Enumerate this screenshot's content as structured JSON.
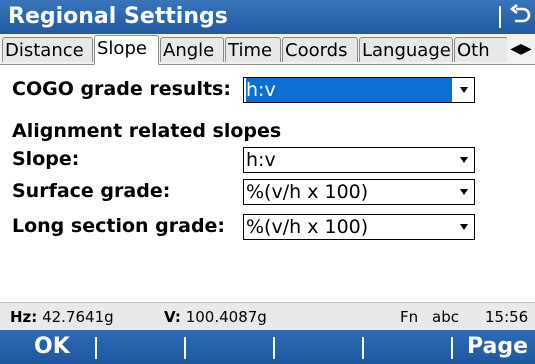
{
  "window": {
    "title": "Regional Settings"
  },
  "tabs": [
    {
      "label": "Distance"
    },
    {
      "label": "Slope"
    },
    {
      "label": "Angle"
    },
    {
      "label": "Time"
    },
    {
      "label": "Coords"
    },
    {
      "label": "Language"
    },
    {
      "label": "Oth"
    }
  ],
  "tab_scroll": {
    "left": "◀",
    "right": "▶"
  },
  "form": {
    "cogo": {
      "label": "COGO grade results:",
      "value": "h:v"
    },
    "section_heading": "Alignment related slopes",
    "slope": {
      "label": "Slope:",
      "value": "h:v"
    },
    "surface_grade": {
      "label": "Surface grade:",
      "value": "%(v/h x 100)"
    },
    "long_section_grade": {
      "label": "Long section grade:",
      "value": "%(v/h x 100)"
    }
  },
  "status_bar": {
    "hz_label": "Hz:",
    "hz_value": "42.7641g",
    "v_label": "V:",
    "v_value": "100.4087g",
    "fn": "Fn",
    "input_mode": "abc",
    "time": "15:56"
  },
  "function_keys": {
    "f1": "OK",
    "f6": "Page"
  },
  "colors": {
    "titlebar": "#2a66b0",
    "selection": "#0b6fd6"
  }
}
